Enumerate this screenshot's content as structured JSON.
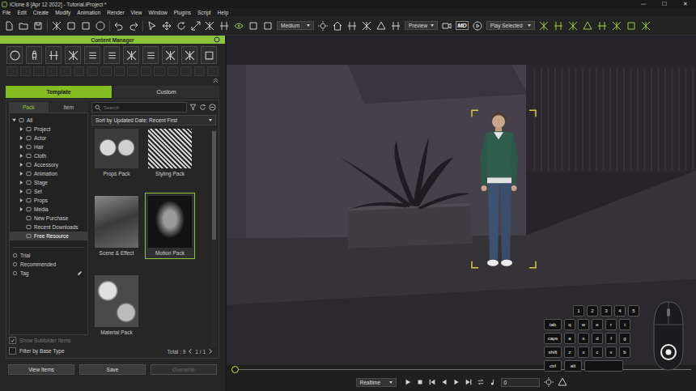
{
  "window": {
    "title": "iClone 8 [Apr 12 2022] - Tutorial.iProject *",
    "controls": [
      "—",
      "☐",
      "✕"
    ]
  },
  "menu": [
    "File",
    "Edit",
    "Create",
    "Modify",
    "Animation",
    "Render",
    "View",
    "Window",
    "Plugins",
    "Script",
    "Help"
  ],
  "toolbar": {
    "quality": "Medium",
    "preview": "Preview",
    "logo": "MD",
    "play_mode": "Play Selected"
  },
  "content_manager": {
    "title": "Content Manager",
    "tabs": [
      {
        "label": "Template",
        "selected": true
      },
      {
        "label": "Custom",
        "selected": false
      }
    ],
    "subtabs": [
      {
        "label": "Pack",
        "selected": true
      },
      {
        "label": "Item",
        "selected": false
      }
    ],
    "search": {
      "placeholder": "Search"
    },
    "sort": "Sort by Updated Date: Recent First",
    "tree": [
      {
        "label": "All",
        "depth": 0,
        "has_children": true,
        "expanded": true,
        "selected": false
      },
      {
        "label": "Project",
        "depth": 1,
        "has_children": true,
        "expanded": false,
        "selected": false
      },
      {
        "label": "Actor",
        "depth": 1,
        "has_children": true,
        "expanded": false,
        "selected": false
      },
      {
        "label": "Hair",
        "depth": 1,
        "has_children": true,
        "expanded": false,
        "selected": false
      },
      {
        "label": "Cloth",
        "depth": 1,
        "has_children": true,
        "expanded": false,
        "selected": false
      },
      {
        "label": "Accessory",
        "depth": 1,
        "has_children": true,
        "expanded": false,
        "selected": false
      },
      {
        "label": "Animation",
        "depth": 1,
        "has_children": true,
        "expanded": false,
        "selected": false
      },
      {
        "label": "Stage",
        "depth": 1,
        "has_children": true,
        "expanded": false,
        "selected": false
      },
      {
        "label": "Set",
        "depth": 1,
        "has_children": true,
        "expanded": false,
        "selected": false
      },
      {
        "label": "Props",
        "depth": 1,
        "has_children": true,
        "expanded": false,
        "selected": false
      },
      {
        "label": "Media",
        "depth": 1,
        "has_children": true,
        "expanded": false,
        "selected": false
      },
      {
        "label": "New Purchase",
        "depth": 1,
        "has_children": false,
        "expanded": false,
        "selected": false
      },
      {
        "label": "Recent Downloads",
        "depth": 1,
        "has_children": false,
        "expanded": false,
        "selected": false
      },
      {
        "label": "Free Resource",
        "depth": 1,
        "has_children": false,
        "expanded": false,
        "selected": true
      }
    ],
    "shortcuts": [
      {
        "label": "Trial",
        "editable": false
      },
      {
        "label": "Recommended",
        "editable": false
      },
      {
        "label": "Tag",
        "editable": true
      }
    ],
    "items": [
      {
        "label": "Props Pack",
        "selected": false
      },
      {
        "label": "Styling Pack",
        "selected": false
      },
      {
        "label": "Scene & Effect",
        "selected": false
      },
      {
        "label": "Motion Pack",
        "selected": true
      },
      {
        "label": "Material Pack",
        "selected": false
      }
    ],
    "scroll": {
      "position": 0.5,
      "level": 0.5
    },
    "options": [
      {
        "label": "Show Subfolder Items",
        "checked": true,
        "disabled": true
      },
      {
        "label": "Filter by Base Type",
        "checked": false,
        "disabled": false
      }
    ],
    "total": "Total : 9",
    "page": "1 / 1",
    "buttons": [
      {
        "label": "View Items",
        "disabled": false
      },
      {
        "label": "Save",
        "disabled": false
      },
      {
        "label": "Overwrite",
        "disabled": true
      }
    ]
  },
  "viewport": {
    "actor": {
      "selected": true
    },
    "keyboard": [
      [
        {
          "label": "1",
          "kind": "key"
        },
        {
          "label": "2",
          "kind": "key"
        },
        {
          "label": "3",
          "kind": "key"
        },
        {
          "label": "4",
          "kind": "key"
        },
        {
          "label": "5",
          "kind": "key"
        }
      ],
      [
        {
          "label": "tab",
          "kind": "wide"
        },
        {
          "label": "q",
          "kind": "key"
        },
        {
          "label": "w",
          "kind": "key"
        },
        {
          "label": "e",
          "kind": "key"
        },
        {
          "label": "r",
          "kind": "key"
        },
        {
          "label": "t",
          "kind": "key"
        }
      ],
      [
        {
          "label": "caps",
          "kind": "wide"
        },
        {
          "label": "a",
          "kind": "key"
        },
        {
          "label": "s",
          "kind": "key"
        },
        {
          "label": "d",
          "kind": "key"
        },
        {
          "label": "f",
          "kind": "key"
        },
        {
          "label": "g",
          "kind": "key"
        }
      ],
      [
        {
          "label": "shift",
          "kind": "wide"
        },
        {
          "label": "z",
          "kind": "key"
        },
        {
          "label": "x",
          "kind": "key"
        },
        {
          "label": "c",
          "kind": "key"
        },
        {
          "label": "v",
          "kind": "key"
        },
        {
          "label": "b",
          "kind": "key"
        }
      ],
      [
        {
          "label": "ctrl",
          "kind": "wide"
        },
        {
          "label": "alt",
          "kind": "wide"
        },
        {
          "label": "",
          "kind": "space"
        }
      ]
    ]
  },
  "timeline": {
    "mode": "Realtime",
    "frame": "0",
    "level": 0
  }
}
